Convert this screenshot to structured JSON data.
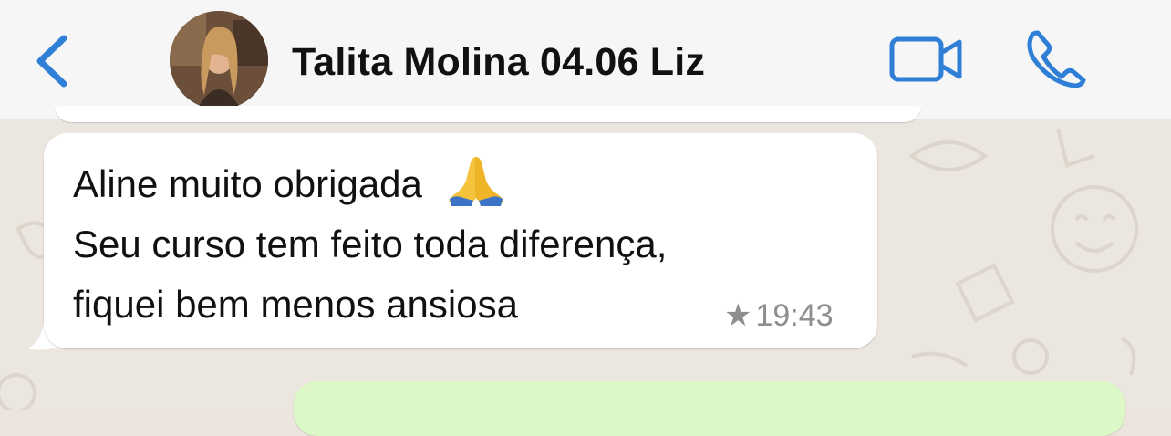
{
  "header": {
    "contact_name": "Talita Molina 04.06 Liz",
    "back_icon": "chevron-left-icon",
    "video_icon": "video-camera-icon",
    "phone_icon": "phone-icon",
    "accent_color": "#2f7fd6"
  },
  "messages": [
    {
      "direction": "incoming",
      "lines": [
        "Aline muito obrigada",
        "Seu curso tem feito toda diferença,",
        "fiquei bem menos ansiosa"
      ],
      "emoji": "folded-hands-emoji",
      "starred": true,
      "time": "19:43"
    },
    {
      "direction": "outgoing",
      "text": ""
    }
  ],
  "colors": {
    "chat_background": "#ebe6df",
    "incoming_bubble": "#ffffff",
    "outgoing_bubble": "#dcf8c6",
    "header_background": "#f6f6f6"
  }
}
